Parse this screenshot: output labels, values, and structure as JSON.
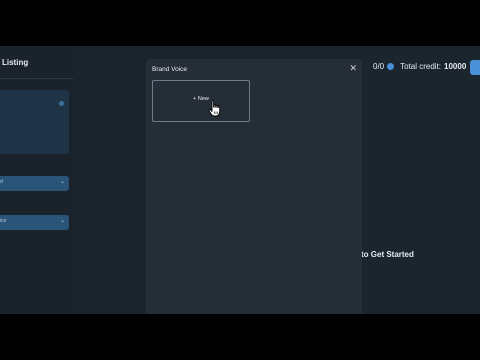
{
  "sidebar": {
    "title": "Listing",
    "select_1_value": "d",
    "select_2_value": "ice"
  },
  "topbar": {
    "usage": "0/0",
    "credit_label": "Total credit:",
    "credit_value": "10000"
  },
  "main": {
    "cta_text": "to Get Started"
  },
  "modal": {
    "title": "Brand Voice",
    "close_icon": "✕",
    "new_label": "+ New"
  },
  "icons": {
    "chevron": "⌄",
    "cursor": "hand-pointer-icon"
  },
  "colors": {
    "accent": "#4a90d9",
    "modal_bg": "#252e36",
    "page_bg": "#1b252e"
  }
}
